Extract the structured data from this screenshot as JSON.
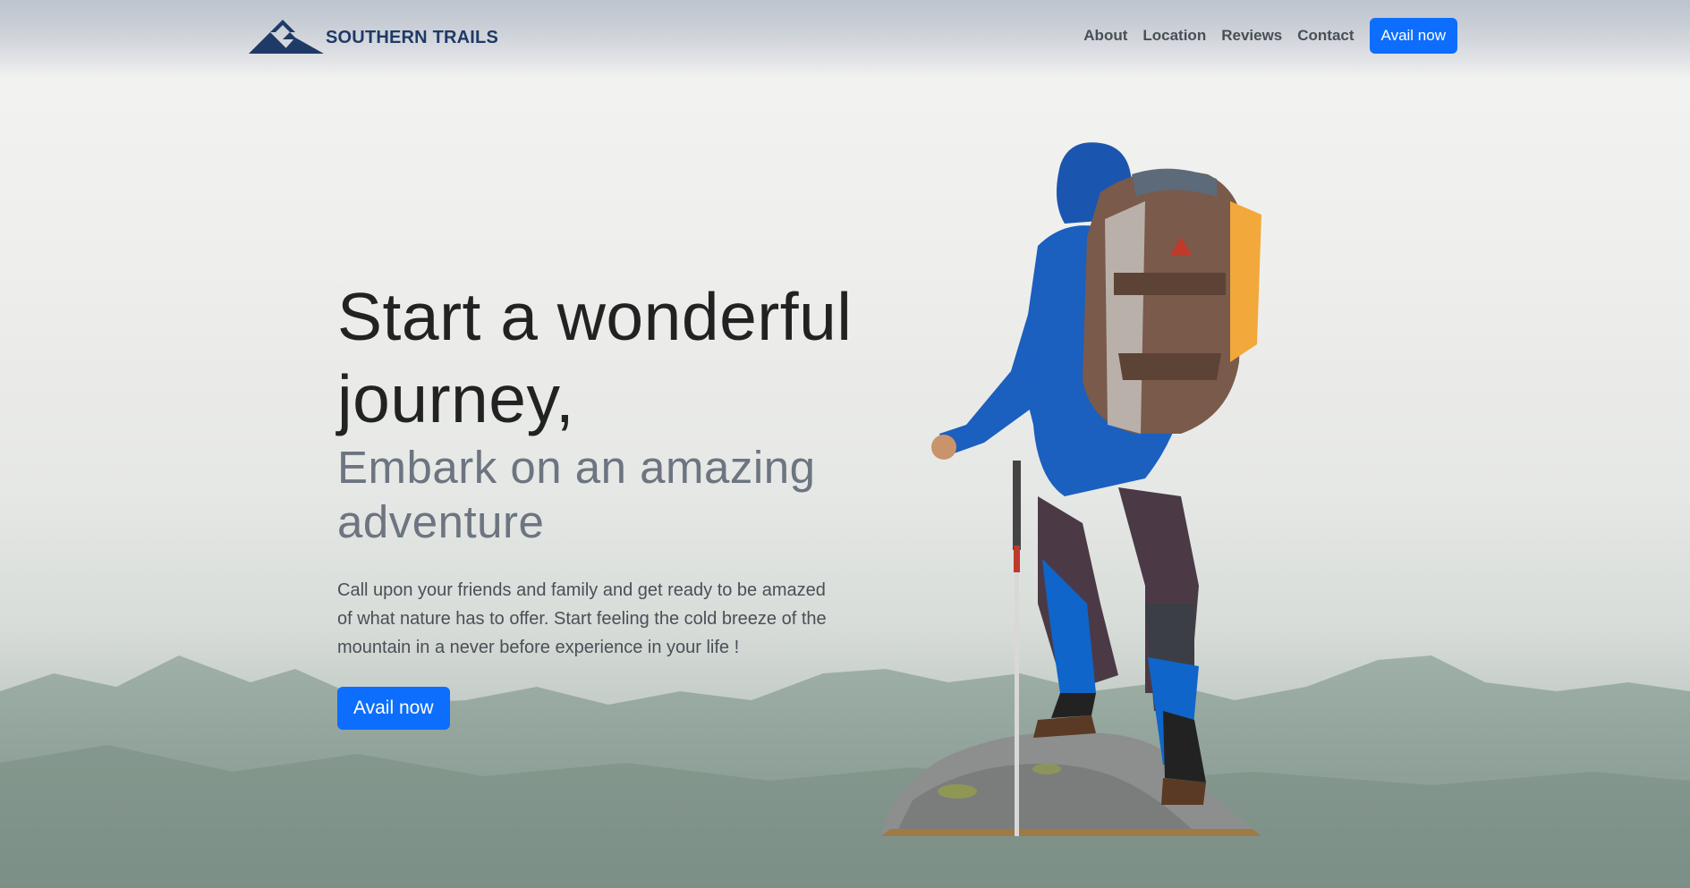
{
  "brand": {
    "name": "SOUTHERN TRAILS",
    "logo_icon": "mountain-logo-icon",
    "color": "#1f3a66"
  },
  "nav": {
    "links": [
      "About",
      "Location",
      "Reviews",
      "Contact"
    ],
    "cta_label": "Avail now"
  },
  "hero": {
    "title": "Start a wonderful journey,",
    "subtitle": "Embark on an amazing adventure",
    "description": "Call upon your friends and family and get ready to be amazed of what nature has to offer. Start feeling the cold breeze of the mountain in a never before experience in your life !",
    "cta_label": "Avail now",
    "image": "hiker-on-rock-image"
  },
  "colors": {
    "accent": "#0d6efd",
    "heading": "#222222",
    "subheading": "#6c7580"
  }
}
